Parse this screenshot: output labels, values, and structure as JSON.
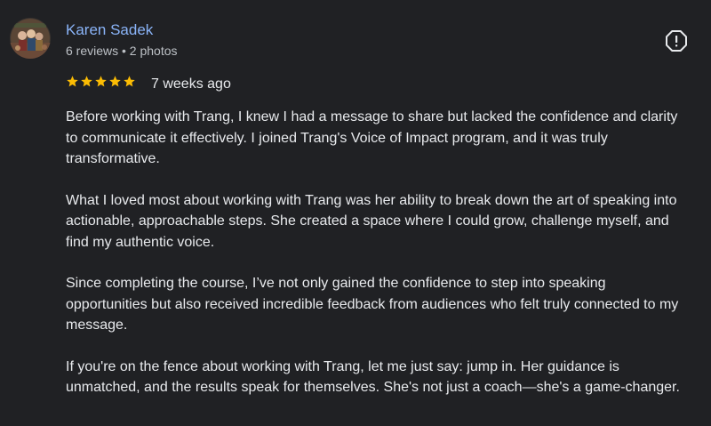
{
  "reviewer": {
    "name": "Karen Sadek",
    "meta": "6 reviews • 2 photos"
  },
  "review": {
    "rating": 5,
    "star_color": "#fbbc04",
    "time": "7 weeks ago",
    "paragraphs": [
      "Before working with Trang, I knew I had a message to share but lacked the confidence and clarity to communicate it effectively. I joined Trang's Voice of Impact program, and it was truly transformative.",
      "What I loved most about working with Trang was her ability to break down the art of speaking into actionable, approachable steps. She created a space where I could grow, challenge myself, and find my authentic voice.",
      "Since completing the course, I’ve not only gained the confidence to step into speaking opportunities but also received incredible feedback from audiences who felt truly connected to my message.",
      "If you're on the fence about working with Trang, let me just say: jump in. Her guidance is unmatched, and the results speak for themselves. She's not just a coach—she's a game-changer."
    ]
  },
  "icons": {
    "report": "report-icon",
    "star": "star-icon"
  }
}
